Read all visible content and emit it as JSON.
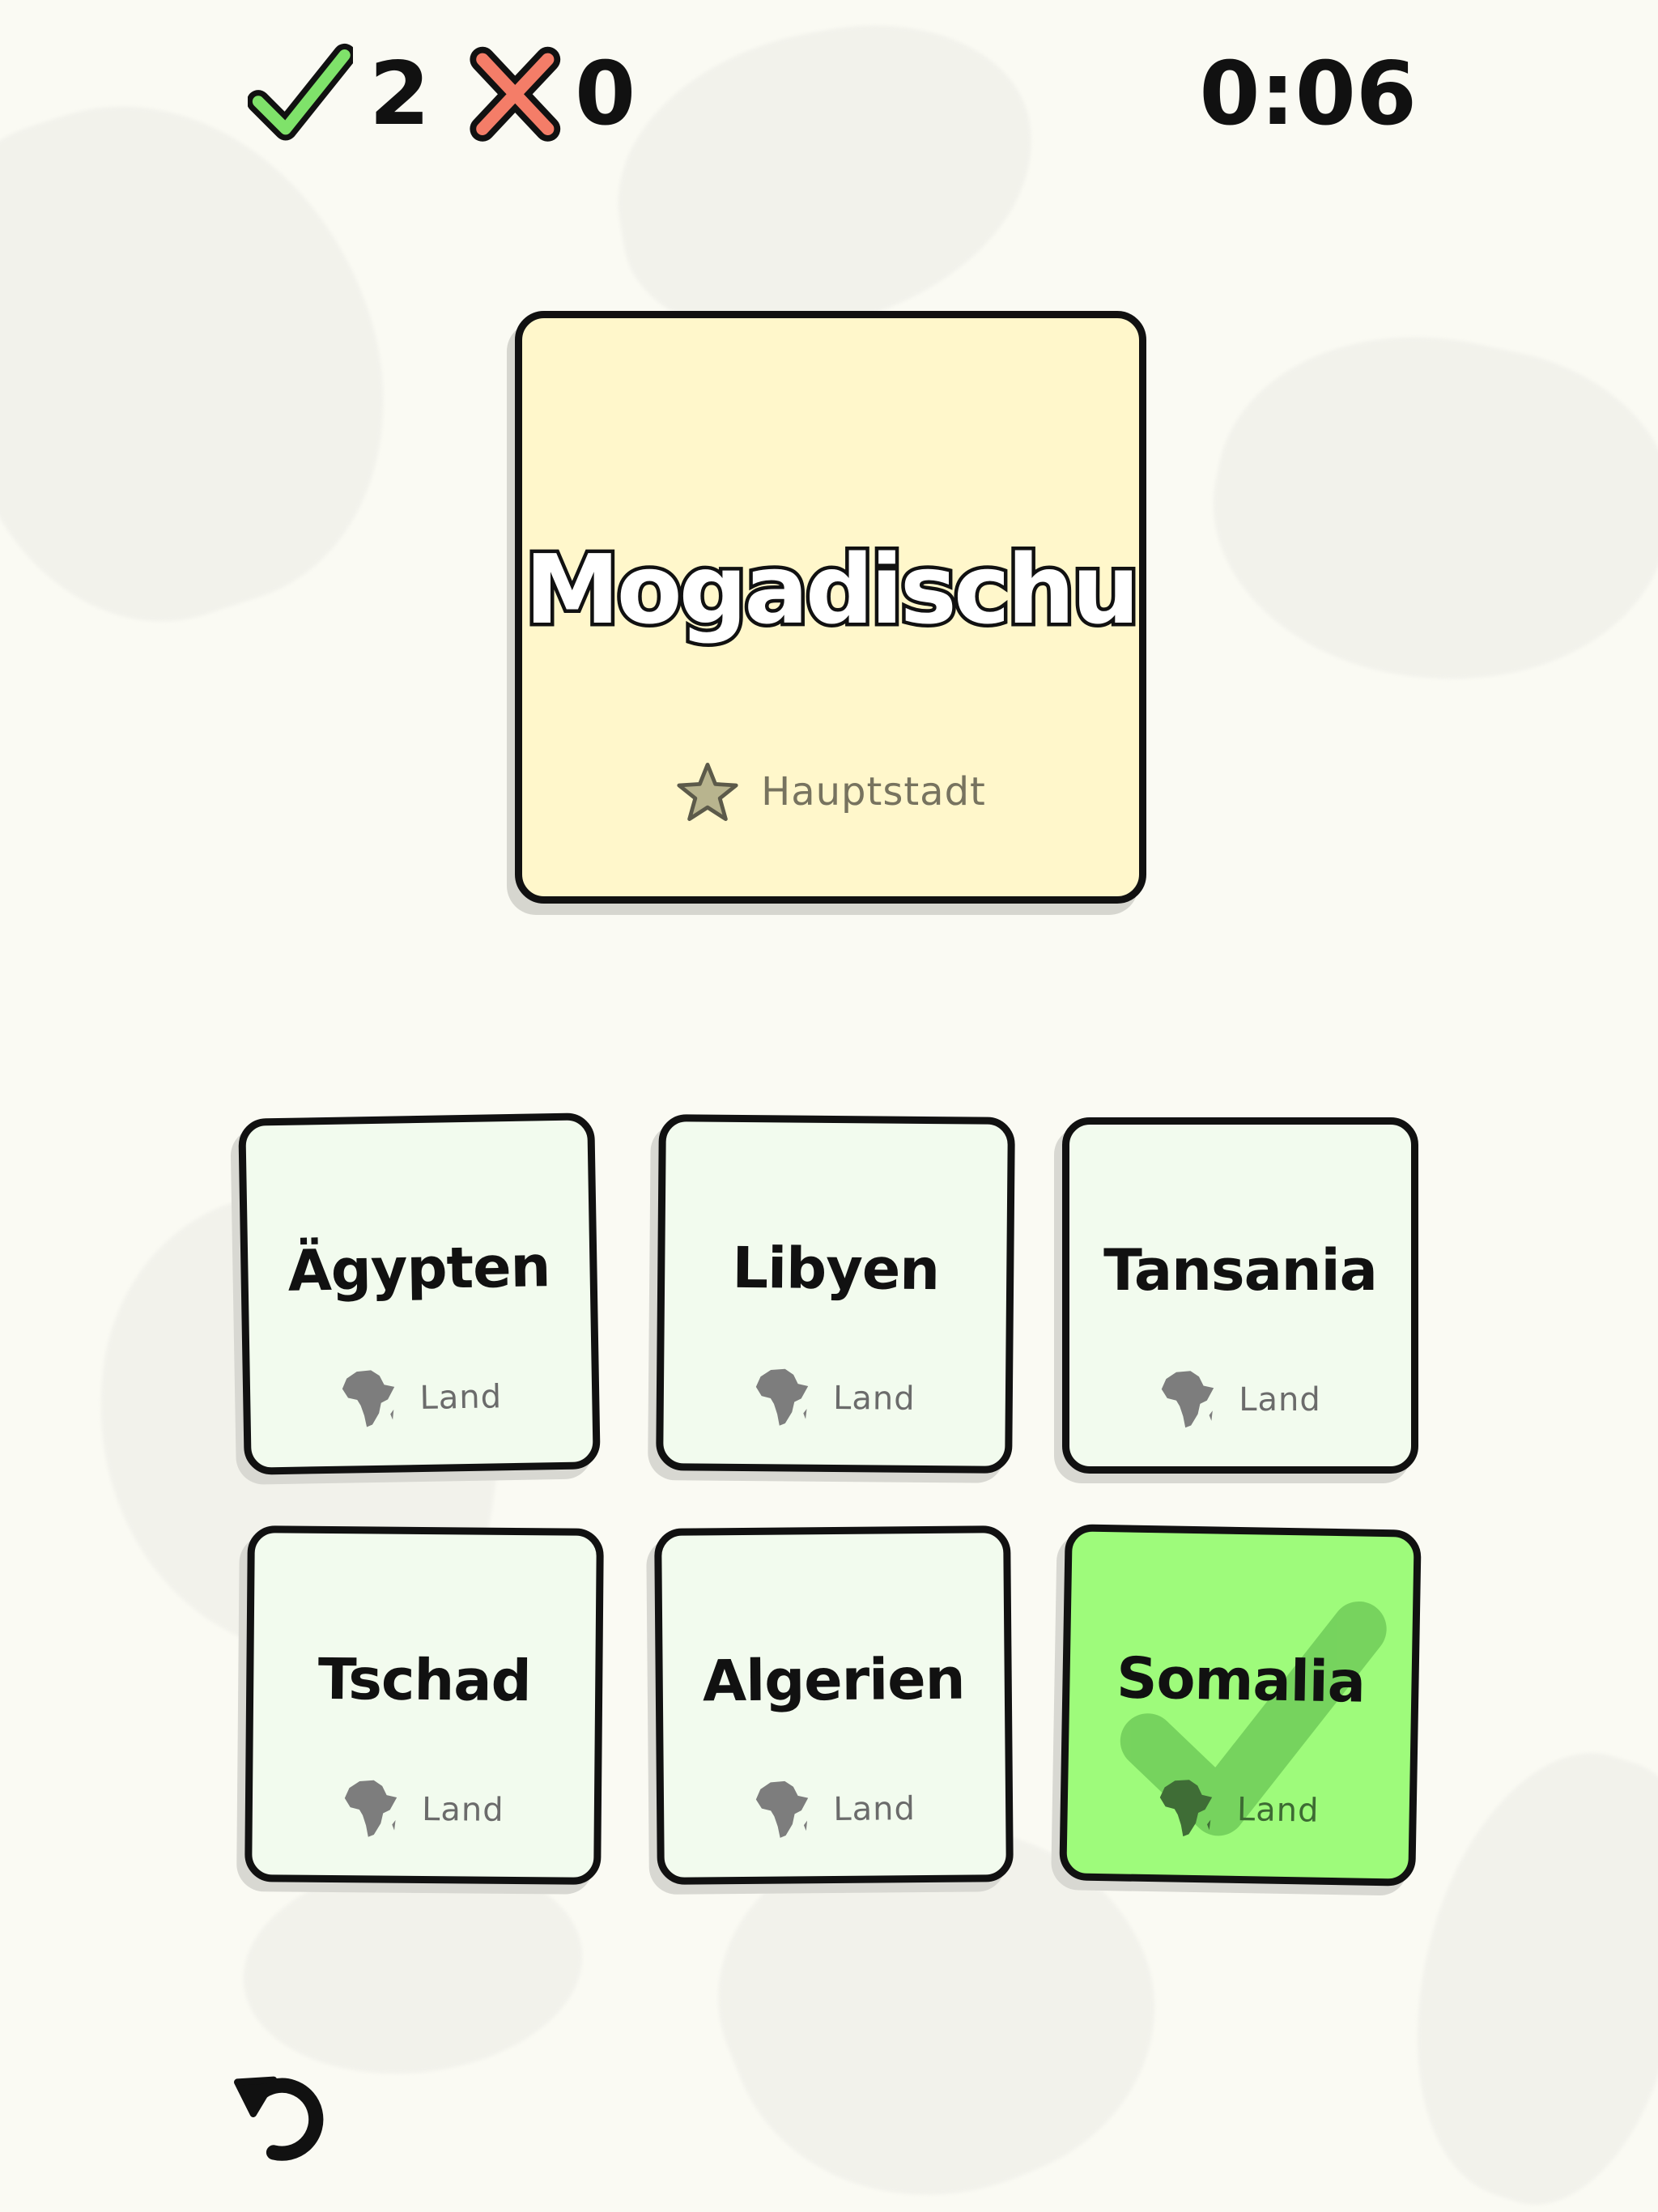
{
  "hud": {
    "correct_count": "2",
    "wrong_count": "0",
    "timer": "0:06",
    "correct_icon": "check-icon",
    "wrong_icon": "cross-icon"
  },
  "prompt": {
    "title": "Mogadischu",
    "category_label": "Hauptstadt",
    "category_icon": "star-icon"
  },
  "options": [
    {
      "label": "Ägypten",
      "category": "Land",
      "icon": "africa-icon",
      "state": "default"
    },
    {
      "label": "Libyen",
      "category": "Land",
      "icon": "africa-icon",
      "state": "default"
    },
    {
      "label": "Tansania",
      "category": "Land",
      "icon": "africa-icon",
      "state": "default"
    },
    {
      "label": "Tschad",
      "category": "Land",
      "icon": "africa-icon",
      "state": "default"
    },
    {
      "label": "Algerien",
      "category": "Land",
      "icon": "africa-icon",
      "state": "default"
    },
    {
      "label": "Somalia",
      "category": "Land",
      "icon": "africa-icon",
      "state": "correct"
    }
  ],
  "footer": {
    "undo_icon": "undo-icon"
  },
  "colors": {
    "background": "#fafaf3",
    "prompt_card": "#fff7cb",
    "option_card": "#f2fbee",
    "correct_card": "#9efb7b",
    "check_green": "#7fe26a",
    "cross_red": "#f47d68",
    "outline": "#111111"
  }
}
